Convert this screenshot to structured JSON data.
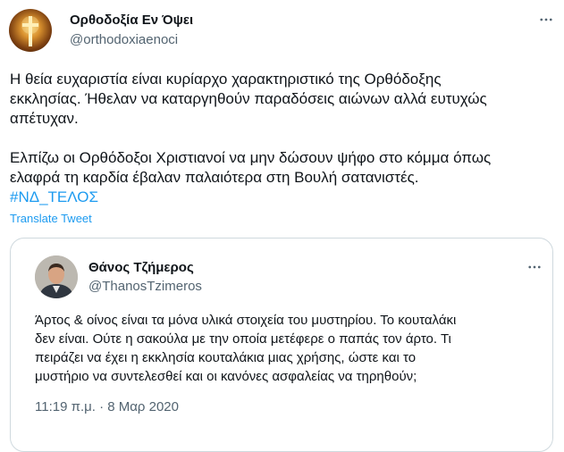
{
  "tweet": {
    "author": {
      "display_name": "Ορθοδοξία Εν Όψει",
      "handle": "@orthodoxiaenoci"
    },
    "text_lines": [
      "Η θεία ευχαριστία είναι κυρίαρχο χαρακτηριστικό της Ορθόδοξης",
      "εκκλησίας. Ήθελαν να καταργηθούν παραδόσεις αιώνων αλλά ευτυχώς",
      "απέτυχαν.",
      "Ελπίζω οι Ορθόδοξοι Χριστιανοί να μην δώσουν ψήφο στο κόμμα όπως",
      "ελαφρά τη καρδία έβαλαν παλαιότερα στη Βουλή σατανιστές."
    ],
    "hashtag": "#ΝΔ_ΤΕΛΟΣ",
    "translate_label": "Translate Tweet",
    "more_icon": "more-horizontal-icon"
  },
  "quoted_tweet": {
    "author": {
      "display_name": "Θάνος Τζήμερος",
      "handle": "@ThanosTzimeros"
    },
    "text_lines": [
      "Άρτος & οίνος είναι τα μόνα υλικά στοιχεία του μυστηρίου. Το κουταλάκι",
      "δεν είναι. Ούτε η σακούλα με την οποία μετέφερε ο παπάς τον άρτο. Τι",
      "πειράζει να έχει η εκκλησία κουταλάκια μιας χρήσης, ώστε και το",
      "μυστήριο να συντελεσθεί και οι κανόνες ασφαλείας να τηρηθούν;"
    ],
    "timestamp": "11:19 π.μ. · 8 Μαρ 2020",
    "more_icon": "more-horizontal-icon"
  },
  "colors": {
    "text": "#0f1419",
    "secondary": "#536471",
    "accent": "#1d9bf0",
    "border": "#cfd9de"
  }
}
